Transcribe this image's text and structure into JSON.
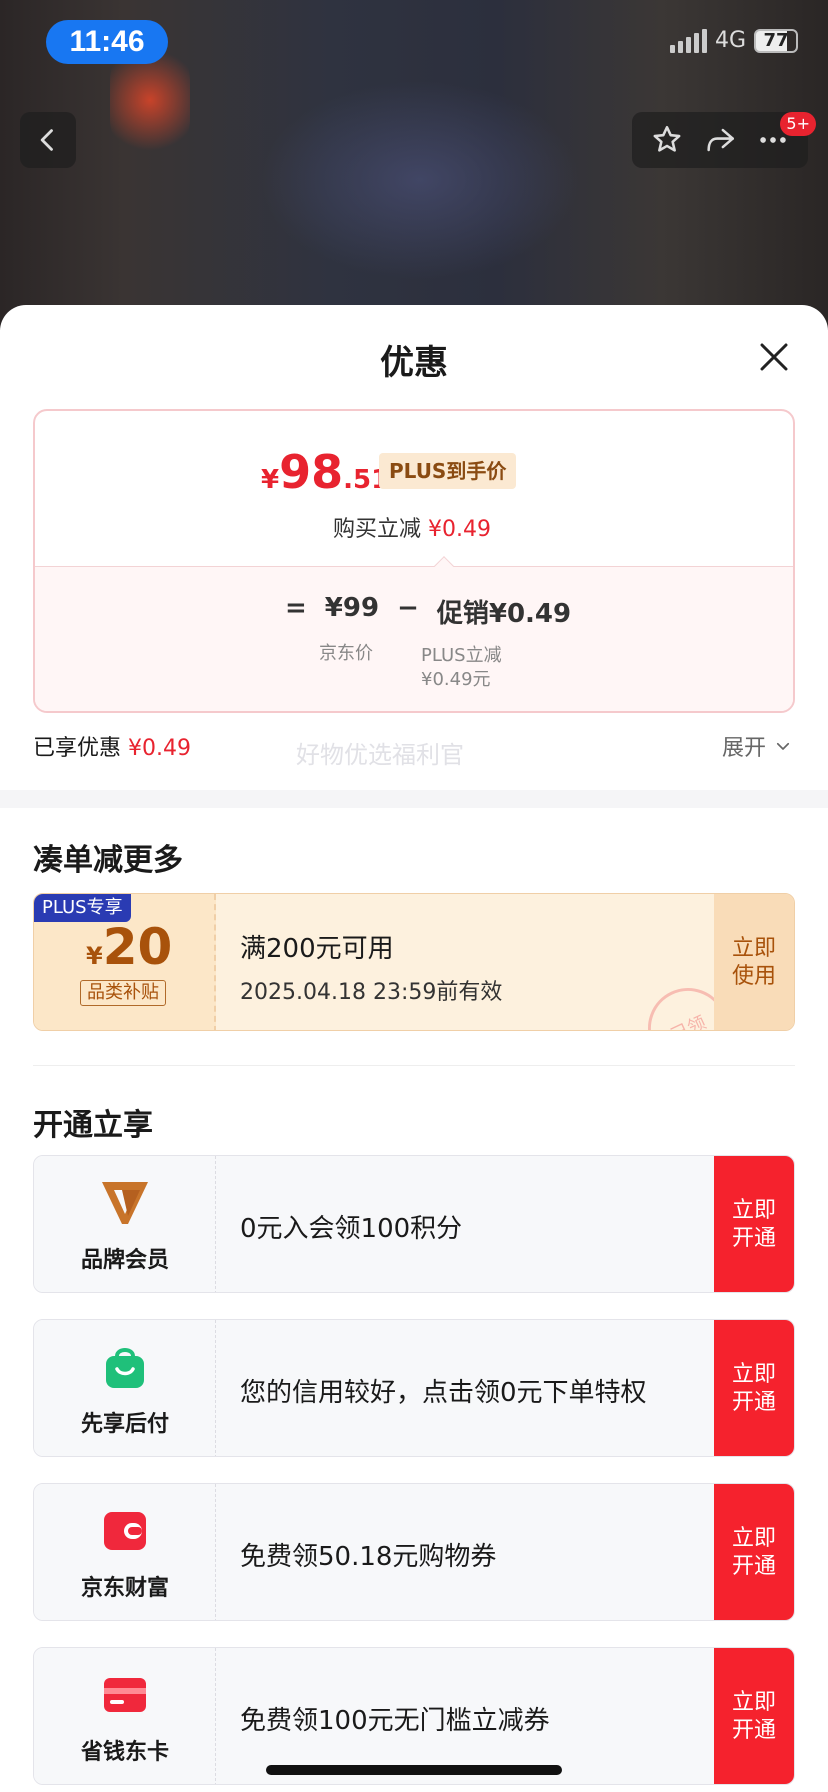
{
  "status": {
    "time": "11:46",
    "network": "4G",
    "battery": "77"
  },
  "nav": {
    "badge": "5+"
  },
  "sheet": {
    "title": "优惠",
    "price": {
      "yen": "¥",
      "integer": "98",
      "decimal": ".51",
      "tag": "PLUS到手价"
    },
    "buy_reduce": {
      "label": "购买立减",
      "amount": "¥0.49"
    },
    "formula": {
      "eq": "=",
      "jd_price": "¥99",
      "minus": "−",
      "promo": "促销¥0.49",
      "jd_price_label": "京东价",
      "plus_label": "PLUS立减",
      "plus_amount": "¥0.49元"
    },
    "enjoyed": {
      "label": "已享优惠",
      "amount": "¥0.49"
    },
    "expand_label": "展开"
  },
  "bundle": {
    "title": "凑单减更多",
    "watermark": "好物优选福利官",
    "coupon": {
      "tag": "PLUS专享",
      "yen": "¥",
      "amount": "20",
      "category": "品类补贴",
      "condition": "满200元可用",
      "valid_until": "2025.04.18 23:59前有效",
      "button": "立即使用",
      "stamp": "已领"
    }
  },
  "open": {
    "title": "开通立享",
    "items": [
      {
        "name": "品牌会员",
        "desc": "0元入会领100积分",
        "button": "立即开通",
        "icon": "brand-v-icon"
      },
      {
        "name": "先享后付",
        "desc": "您的信用较好，点击领0元下单特权",
        "button": "立即开通",
        "icon": "green-bag-icon"
      },
      {
        "name": "京东财富",
        "desc": "免费领50.18元购物券",
        "button": "立即开通",
        "icon": "wallet-icon"
      },
      {
        "name": "省钱东卡",
        "desc": "免费领100元无门槛立减券",
        "button": "立即开通",
        "icon": "card-icon"
      }
    ]
  },
  "colors": {
    "accent_red": "#e8232f",
    "coupon_brown": "#a8520b",
    "plus_blue": "#2a3bb3"
  }
}
